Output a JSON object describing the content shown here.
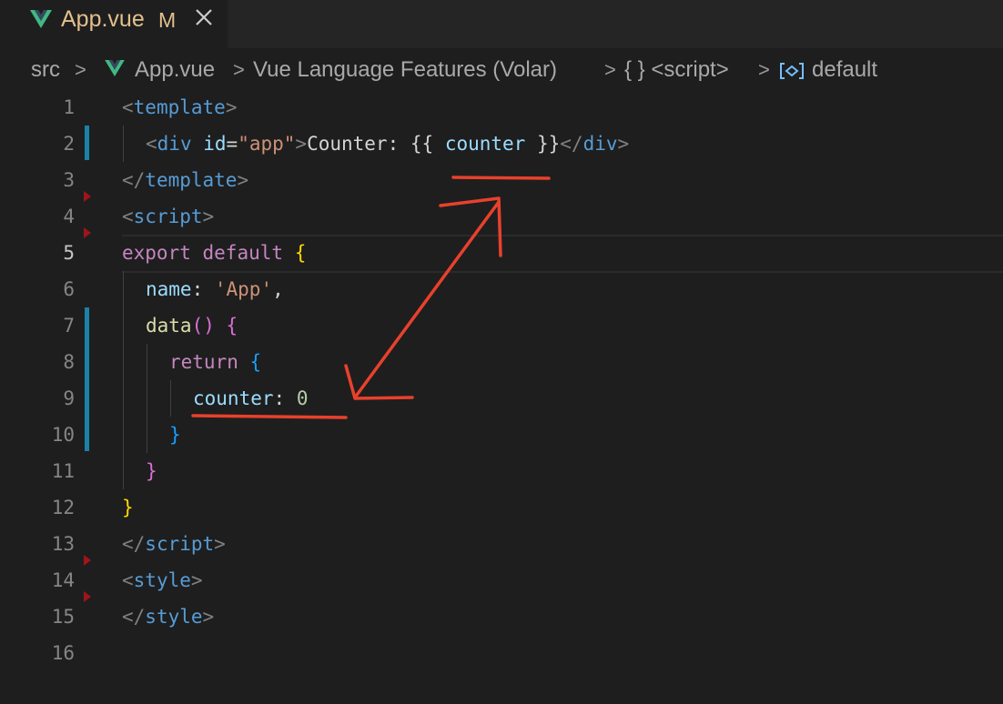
{
  "tab": {
    "filename": "App.vue",
    "modified_badge": "M",
    "close_icon": "close-icon",
    "file_icon": "vue-icon"
  },
  "breadcrumb": {
    "items": [
      "src",
      "App.vue",
      "Vue Language Features (Volar)",
      "{ } <script>",
      "default"
    ],
    "separator": ">"
  },
  "editor": {
    "line_numbers": [
      "1",
      "2",
      "3",
      "4",
      "5",
      "6",
      "7",
      "8",
      "9",
      "10",
      "11",
      "12",
      "13",
      "14",
      "15",
      "16"
    ],
    "active_line": "5",
    "lines": [
      {
        "tokens": [
          "<",
          "template",
          ">"
        ]
      },
      {
        "tokens": [
          "<",
          "div",
          " ",
          "id",
          "=",
          "\"app\"",
          ">",
          "Counter: ",
          "{{ ",
          "counter",
          " }}",
          "</",
          "div",
          ">"
        ]
      },
      {
        "tokens": [
          "</",
          "template",
          ">"
        ]
      },
      {
        "tokens": [
          "<",
          "script",
          ">"
        ]
      },
      {
        "tokens": [
          "export",
          " ",
          "default",
          " ",
          "{"
        ]
      },
      {
        "tokens": [
          "name",
          ": ",
          "'App'",
          ","
        ]
      },
      {
        "tokens": [
          "data",
          "()",
          " ",
          "{"
        ]
      },
      {
        "tokens": [
          "return",
          " ",
          "{"
        ]
      },
      {
        "tokens": [
          "counter",
          ": ",
          "0"
        ]
      },
      {
        "tokens": [
          "}"
        ]
      },
      {
        "tokens": [
          "}"
        ]
      },
      {
        "tokens": [
          "}"
        ]
      },
      {
        "tokens": [
          "</",
          "script",
          ">"
        ]
      },
      {
        "tokens": [
          "<",
          "style",
          ">"
        ]
      },
      {
        "tokens": [
          "</",
          "style",
          ">"
        ]
      },
      {
        "tokens": []
      }
    ]
  },
  "colors": {
    "annotation": "#e8412c",
    "modified_gutter": "#1b81a8",
    "tab_title": "#e2c08d",
    "vue_green": "#41b883"
  }
}
